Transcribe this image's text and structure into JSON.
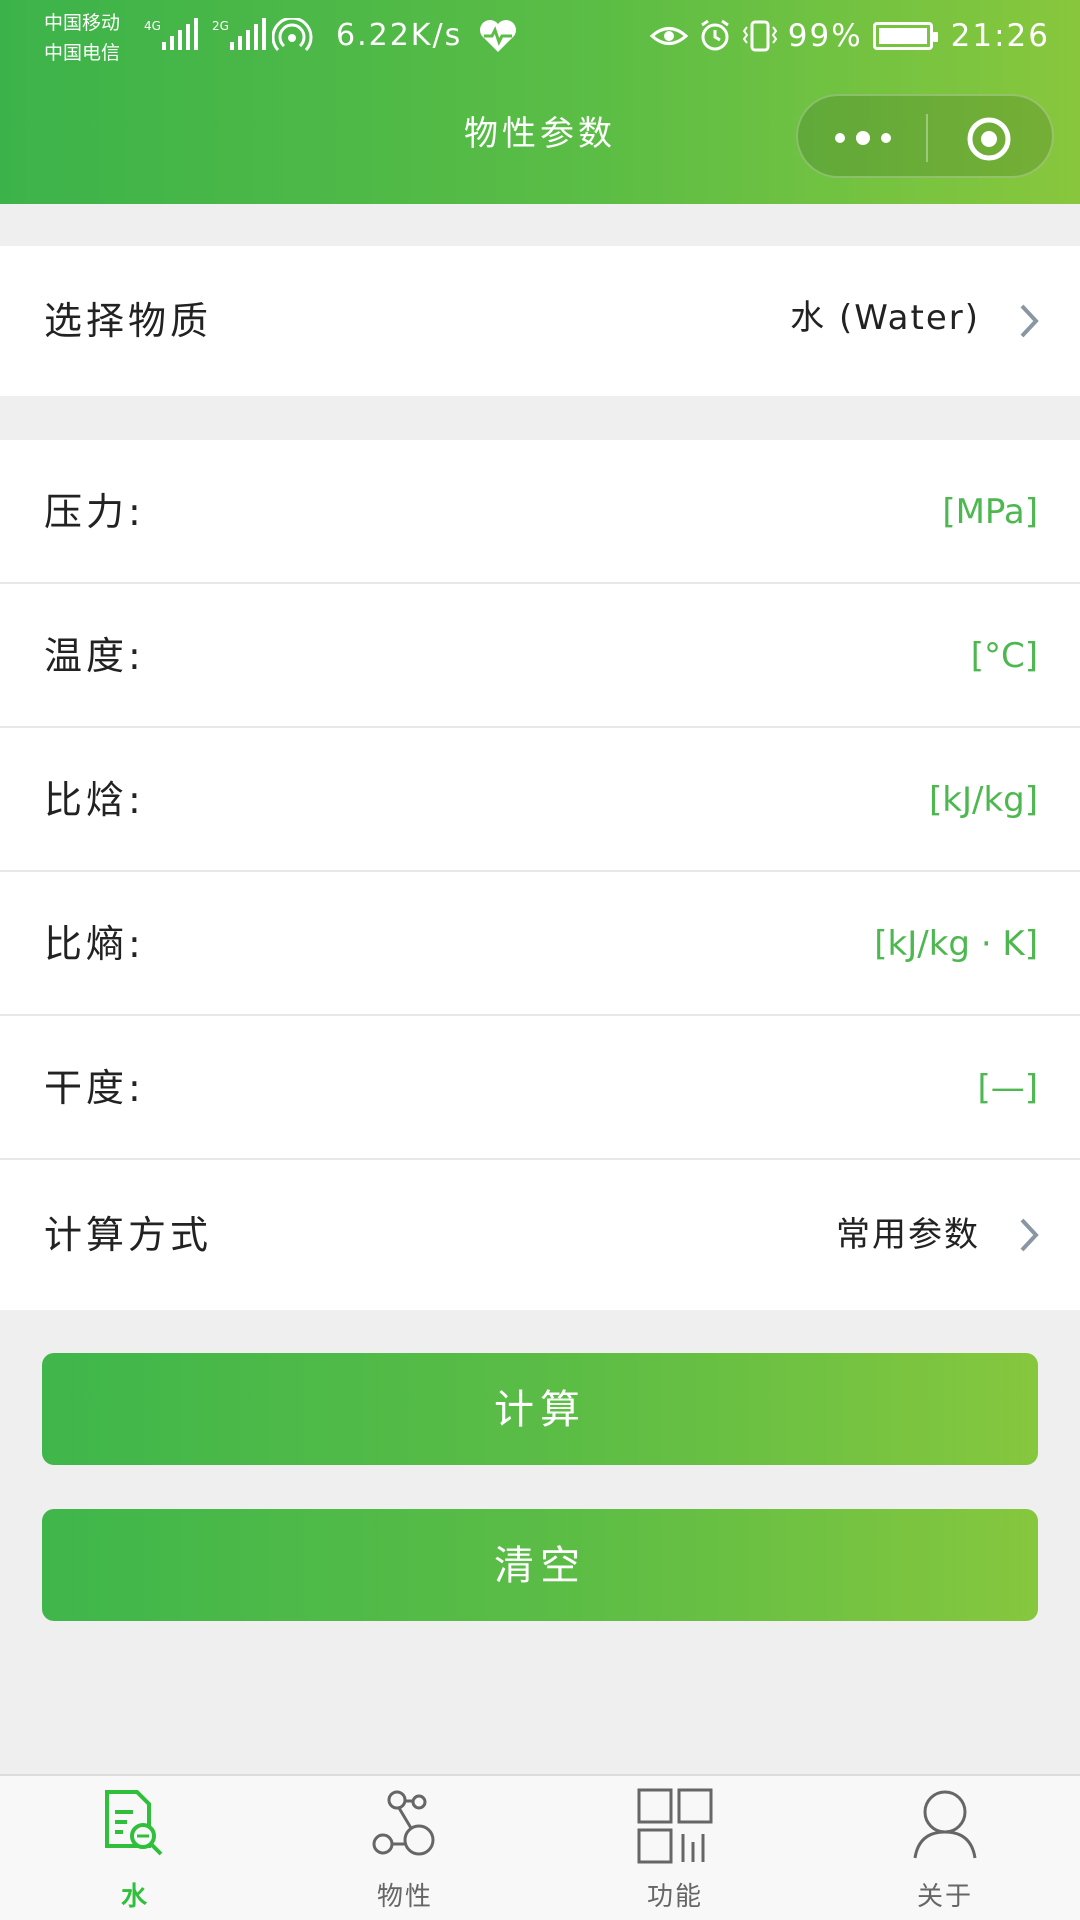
{
  "status_bar": {
    "carrier1": "中国移动",
    "carrier2": "中国电信",
    "net1": "4G",
    "net2": "2G",
    "net_speed": "6.22K/s",
    "battery": "99%",
    "time": "21:26"
  },
  "header": {
    "title": "物性参数"
  },
  "substance": {
    "label": "选择物质",
    "value": "水 (Water)"
  },
  "fields": [
    {
      "label": "压力:",
      "unit": "[MPa]"
    },
    {
      "label": "温度:",
      "unit": "[°C]"
    },
    {
      "label": "比焓:",
      "unit": "[kJ/kg]"
    },
    {
      "label": "比熵:",
      "unit": "[kJ/kg · K]"
    },
    {
      "label": "干度:",
      "unit": "[—]"
    }
  ],
  "method": {
    "label": "计算方式",
    "value": "常用参数"
  },
  "buttons": {
    "calculate": "计算",
    "clear": "清空"
  },
  "tabs": [
    {
      "label": "水",
      "icon": "water-doc-search-icon",
      "active": true
    },
    {
      "label": "物性",
      "icon": "nodes-icon",
      "active": false
    },
    {
      "label": "功能",
      "icon": "grid-icon",
      "active": false
    },
    {
      "label": "关于",
      "icon": "user-icon",
      "active": false
    }
  ],
  "colors": {
    "accent": "#4cb84f",
    "gradient_start": "#3cb34a",
    "gradient_end": "#88c73d",
    "tab_active": "#2fbf3a"
  }
}
